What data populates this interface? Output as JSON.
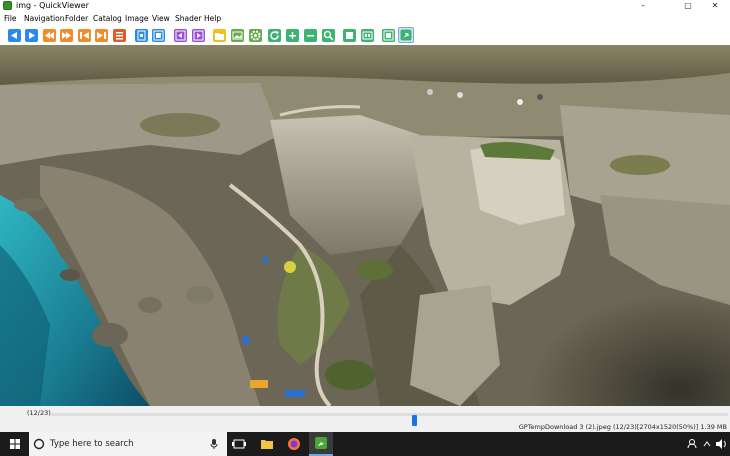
{
  "window": {
    "title": "img - QuickViewer",
    "buttons": {
      "minimize": "–",
      "maximize": "▢",
      "close": "✕"
    }
  },
  "menu": [
    "File",
    "Navigation",
    "Folder",
    "Catalog",
    "Image",
    "View",
    "Shader",
    "Help"
  ],
  "toolbar": {
    "buttons": [
      {
        "name": "prev-page-icon",
        "color": "#2b8ae6"
      },
      {
        "name": "next-page-icon",
        "color": "#2b8ae6"
      },
      {
        "name": "prev-volume-icon",
        "color": "#f08c2a"
      },
      {
        "name": "next-volume-icon",
        "color": "#f08c2a"
      },
      {
        "name": "first-page-icon",
        "color": "#f08c2a"
      },
      {
        "name": "last-page-icon",
        "color": "#f08c2a"
      },
      {
        "name": "volume-list-icon",
        "color": "#e05a2a"
      },
      {
        "name": "dual-view-icon",
        "color": "#2b8ae6"
      },
      {
        "name": "right-to-left-icon",
        "color": "#2b8ae6"
      },
      {
        "name": "single-view-left-icon",
        "color": "#9b4fd6"
      },
      {
        "name": "single-view-right-icon",
        "color": "#9b4fd6"
      },
      {
        "name": "open-folder-icon",
        "color": "#f0c020"
      },
      {
        "name": "gallery-icon",
        "color": "#6aa84f"
      },
      {
        "name": "settings-gear-icon",
        "color": "#6aa84f"
      },
      {
        "name": "rotate-icon",
        "color": "#3cb371"
      },
      {
        "name": "zoom-in-icon",
        "color": "#3cb371"
      },
      {
        "name": "zoom-out-icon",
        "color": "#3cb371"
      },
      {
        "name": "fit-window-icon",
        "color": "#3cb371"
      },
      {
        "name": "full-screen-icon",
        "color": "#3cb371"
      },
      {
        "name": "slideshow-icon",
        "color": "#3cb371"
      },
      {
        "name": "catalog-icon",
        "color": "#3cb371"
      },
      {
        "name": "pin-icon",
        "color": "#3cb371"
      }
    ]
  },
  "status": {
    "page_count": "(12/23)",
    "seek_position": 0.537,
    "file_info": "GPTempDownload 3 (2).jpeg (12/23)[2704x1520(50%)] 1.39 MB"
  },
  "taskbar": {
    "search_placeholder": "Type here to search",
    "apps": [
      "windows-start-icon",
      "cortana-icon",
      "task-view-icon",
      "file-explorer-icon",
      "firefox-icon",
      "quickviewer-app-icon"
    ],
    "tray": [
      "people-icon",
      "chevron-up-icon",
      "speaker-icon"
    ]
  }
}
